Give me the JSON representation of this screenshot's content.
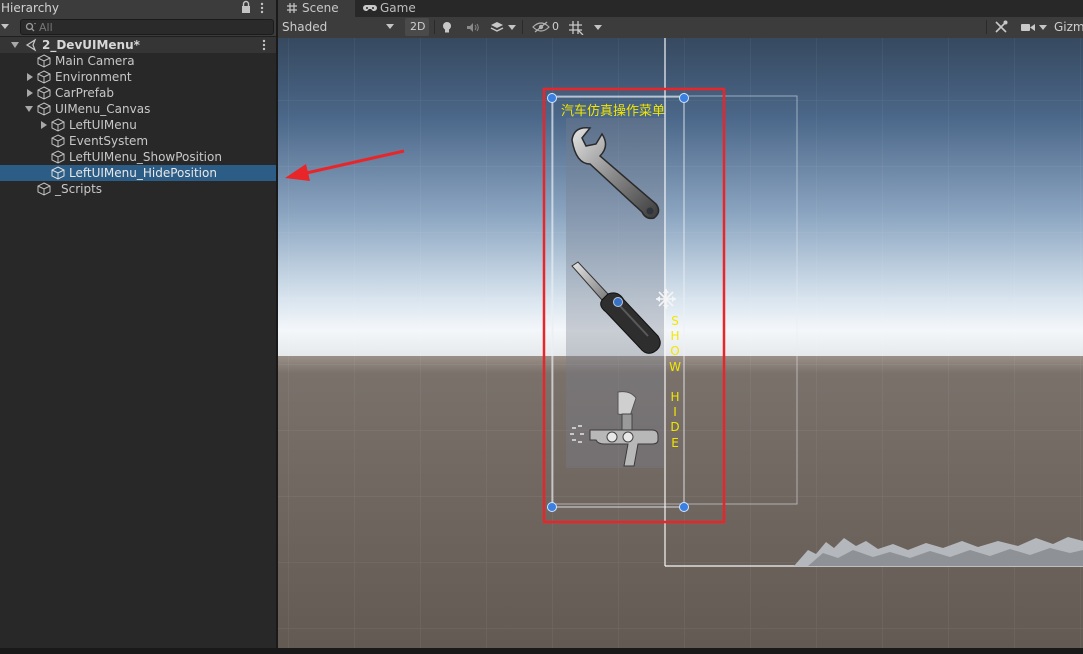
{
  "hierarchy": {
    "tab_title": "Hierarchy",
    "search_placeholder": "All",
    "scene_name": "2_DevUIMenu*",
    "items": [
      {
        "label": "Main Camera"
      },
      {
        "label": "Environment"
      },
      {
        "label": "CarPrefab"
      },
      {
        "label": "UIMenu_Canvas"
      },
      {
        "label": "LeftUIMenu"
      },
      {
        "label": "EventSystem"
      },
      {
        "label": "LeftUIMenu_ShowPosition"
      },
      {
        "label": "LeftUIMenu_HidePosition"
      },
      {
        "label": "_Scripts"
      }
    ],
    "selected_item": "LeftUIMenu_HidePosition"
  },
  "scene_view": {
    "tabs": [
      {
        "label": "Scene",
        "icon": "grid-hash-icon"
      },
      {
        "label": "Game",
        "icon": "gamepad-icon"
      }
    ],
    "toolbar": {
      "shading_mode": "Shaded",
      "toggle_2d": "2D",
      "hidden_count": "0",
      "gizmos_label": "Gizmos"
    },
    "ui_menu": {
      "title": "汽车仿真操作菜单",
      "toggle_text": "S\nH\nO\nW\n\nH\nI\nD\nE",
      "tools": [
        "wrench-icon",
        "screwdriver-icon",
        "spray-gun-icon"
      ]
    }
  },
  "colors": {
    "selection": "#2c5d87",
    "highlight_box": "#e8262a",
    "annotation_arrow": "#e8262a",
    "menu_text": "#f2e600",
    "handle": "#3b7fe0"
  }
}
